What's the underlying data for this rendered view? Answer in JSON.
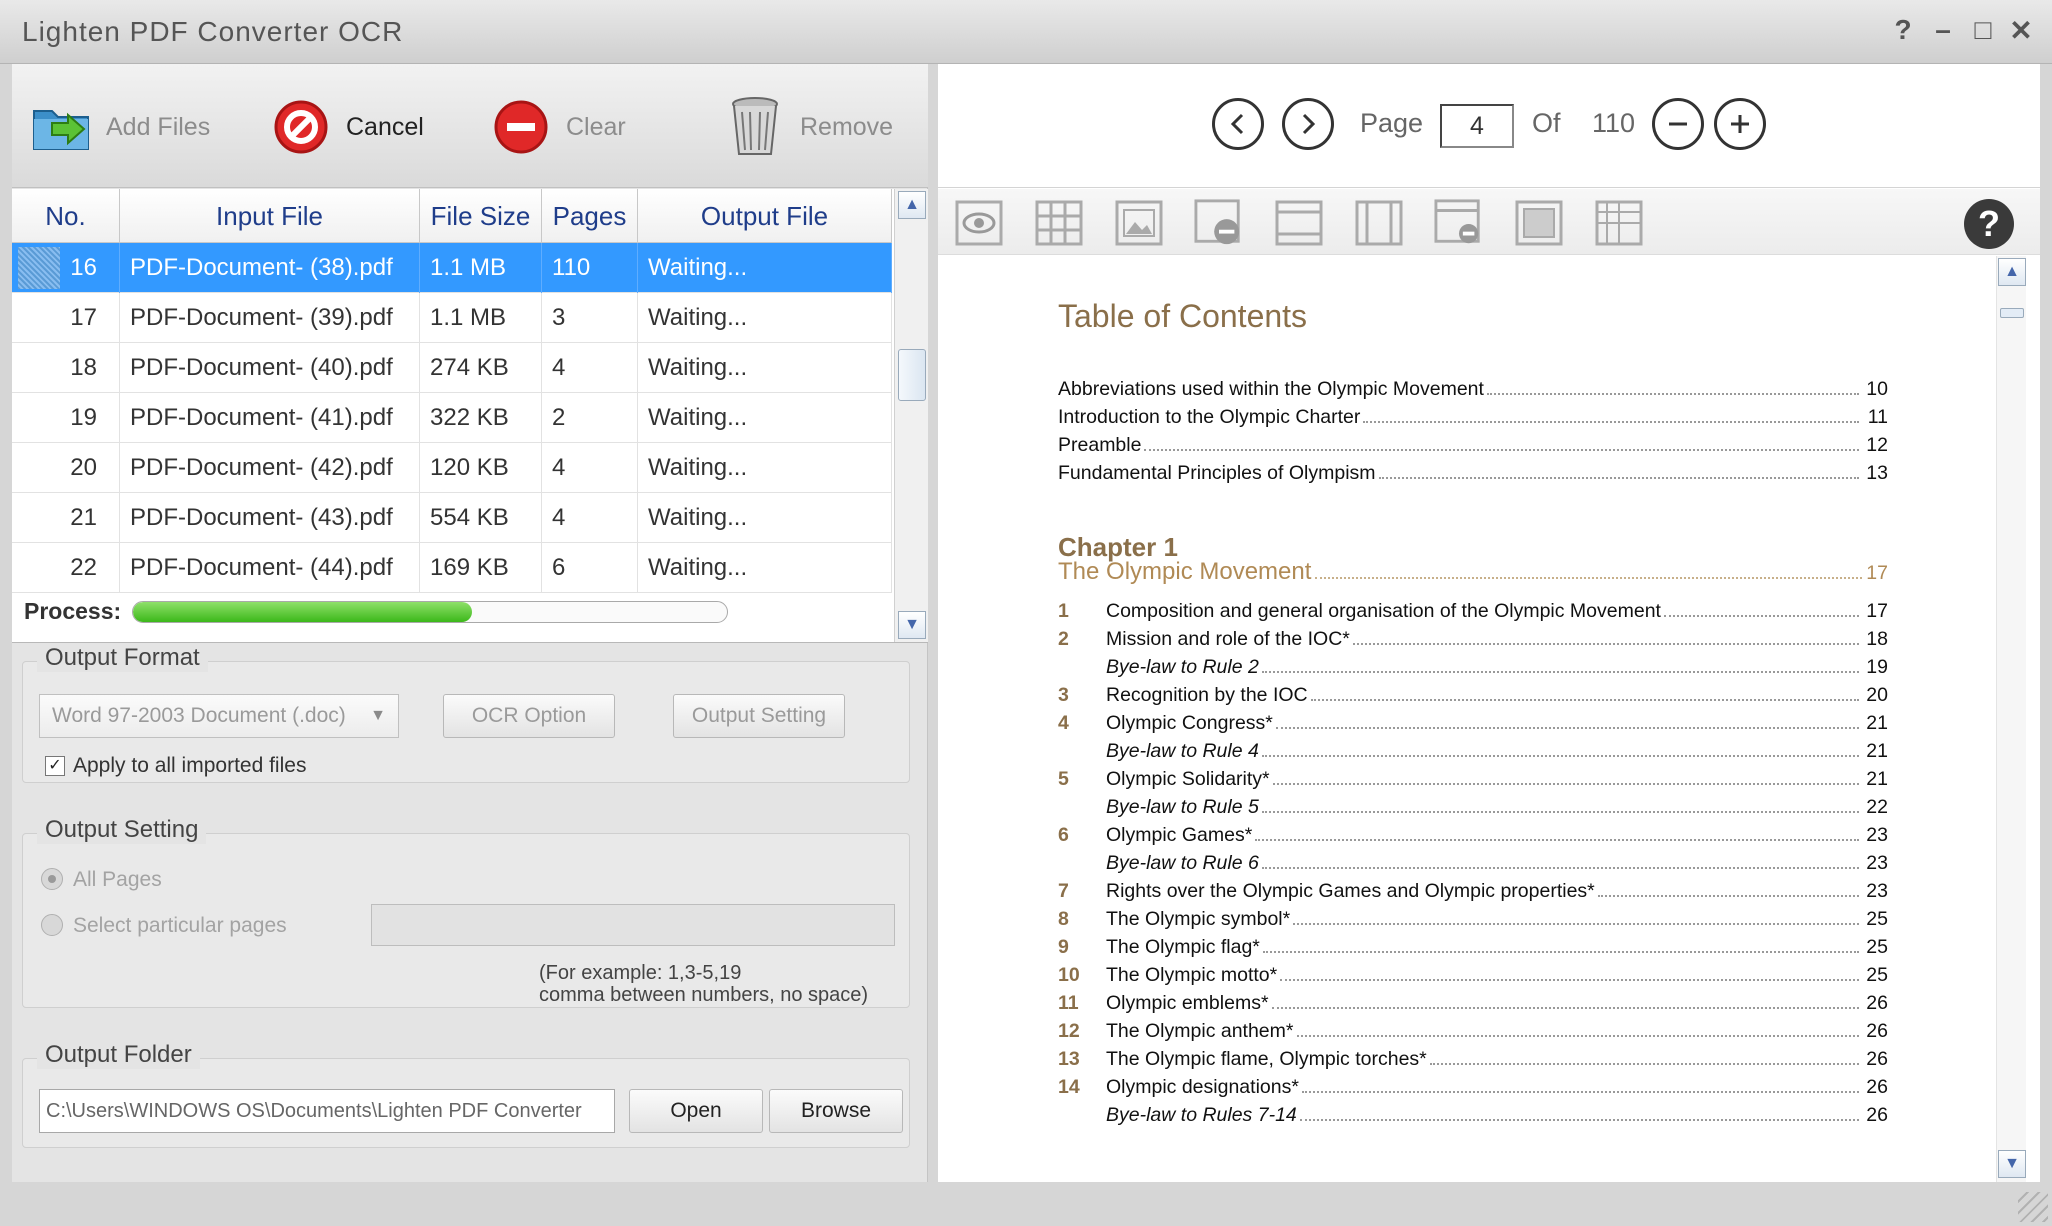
{
  "window": {
    "title": "Lighten PDF Converter OCR",
    "controls": [
      "?",
      "–",
      "□",
      "✕"
    ]
  },
  "toolbar": {
    "add_files": "Add Files",
    "cancel": "Cancel",
    "clear": "Clear",
    "remove": "Remove"
  },
  "table": {
    "columns": [
      "No.",
      "Input File",
      "File Size",
      "Pages",
      "Output File"
    ],
    "rows": [
      {
        "no": "16",
        "file": "PDF-Document- (38).pdf",
        "size": "1.1 MB",
        "pages": "110",
        "output": "Waiting..."
      },
      {
        "no": "17",
        "file": "PDF-Document- (39).pdf",
        "size": "1.1 MB",
        "pages": "3",
        "output": "Waiting..."
      },
      {
        "no": "18",
        "file": "PDF-Document- (40).pdf",
        "size": "274 KB",
        "pages": "4",
        "output": "Waiting..."
      },
      {
        "no": "19",
        "file": "PDF-Document- (41).pdf",
        "size": "322 KB",
        "pages": "2",
        "output": "Waiting..."
      },
      {
        "no": "20",
        "file": "PDF-Document- (42).pdf",
        "size": "120 KB",
        "pages": "4",
        "output": "Waiting..."
      },
      {
        "no": "21",
        "file": "PDF-Document- (43).pdf",
        "size": "554 KB",
        "pages": "4",
        "output": "Waiting..."
      },
      {
        "no": "22",
        "file": "PDF-Document- (44).pdf",
        "size": "169 KB",
        "pages": "6",
        "output": "Waiting..."
      }
    ],
    "selected_row": 0
  },
  "process": {
    "label": "Process:",
    "progress": 0.57
  },
  "output_format": {
    "title": "Output Format",
    "select_value": "Word 97-2003 Document (.doc)",
    "ocr_option": "OCR Option",
    "output_setting_btn": "Output Setting",
    "apply_all_label": "Apply to all imported files",
    "apply_all_checked": true
  },
  "output_setting": {
    "title": "Output Setting",
    "all_pages": "All Pages",
    "select_pages": "Select particular pages",
    "pages_value": "",
    "hint_line1": "(For example: 1,3-5,19",
    "hint_line2": "comma between numbers, no space)"
  },
  "output_folder": {
    "title": "Output Folder",
    "path": "C:\\Users\\WINDOWS OS\\Documents\\Lighten PDF Converter",
    "open": "Open",
    "browse": "Browse"
  },
  "viewer": {
    "page_label": "Page",
    "current_page": "4",
    "of_label": "Of",
    "total_pages": "110"
  },
  "viewer_tools": [
    "eye-icon",
    "grid-icon",
    "image-icon",
    "remove-region-icon",
    "horizontal-split-icon",
    "vertical-split-icon",
    "remove-page-icon",
    "frame-icon",
    "table-icon"
  ],
  "document": {
    "title": "Table of Contents",
    "intro": [
      {
        "text": "Abbreviations used within the Olympic Movement",
        "page": "10"
      },
      {
        "text": "Introduction to the Olympic Charter",
        "page": "11"
      },
      {
        "text": "Preamble",
        "page": "12"
      },
      {
        "text": "Fundamental Principles of Olympism",
        "page": "13"
      }
    ],
    "chapter": "Chapter 1",
    "chapter_title": "The Olympic Movement",
    "chapter_page": "17",
    "entries": [
      {
        "num": "1",
        "text": "Composition and general organisation of the Olympic Movement",
        "page": "17",
        "italic": false
      },
      {
        "num": "2",
        "text": "Mission and role of the IOC*",
        "page": "18",
        "italic": false
      },
      {
        "num": "",
        "text": "Bye-law to Rule 2",
        "page": "19",
        "italic": true
      },
      {
        "num": "3",
        "text": "Recognition by the IOC",
        "page": "20",
        "italic": false
      },
      {
        "num": "4",
        "text": "Olympic Congress*",
        "page": "21",
        "italic": false
      },
      {
        "num": "",
        "text": "Bye-law to Rule 4",
        "page": "21",
        "italic": true
      },
      {
        "num": "5",
        "text": "Olympic Solidarity*",
        "page": "21",
        "italic": false
      },
      {
        "num": "",
        "text": "Bye-law to Rule 5",
        "page": "22",
        "italic": true
      },
      {
        "num": "6",
        "text": "Olympic Games*",
        "page": "23",
        "italic": false
      },
      {
        "num": "",
        "text": "Bye-law to Rule 6",
        "page": "23",
        "italic": true
      },
      {
        "num": "7",
        "text": "Rights over the Olympic Games and Olympic properties*",
        "page": "23",
        "italic": false
      },
      {
        "num": "8",
        "text": "The Olympic symbol*",
        "page": "25",
        "italic": false
      },
      {
        "num": "9",
        "text": "The Olympic flag*",
        "page": "25",
        "italic": false
      },
      {
        "num": "10",
        "text": "The Olympic motto*",
        "page": "25",
        "italic": false
      },
      {
        "num": "11",
        "text": "Olympic emblems*",
        "page": "26",
        "italic": false
      },
      {
        "num": "12",
        "text": "The Olympic anthem*",
        "page": "26",
        "italic": false
      },
      {
        "num": "13",
        "text": "The Olympic flame, Olympic torches*",
        "page": "26",
        "italic": false
      },
      {
        "num": "14",
        "text": "Olympic designations*",
        "page": "26",
        "italic": false
      },
      {
        "num": "",
        "text": "Bye-law to Rules 7-14",
        "page": "26",
        "italic": true
      }
    ]
  },
  "colors": {
    "selection": "#3399ff",
    "progress": "#3cb81a",
    "toc_accent": "#8a6f4a",
    "header_text": "#1f3d8a"
  }
}
